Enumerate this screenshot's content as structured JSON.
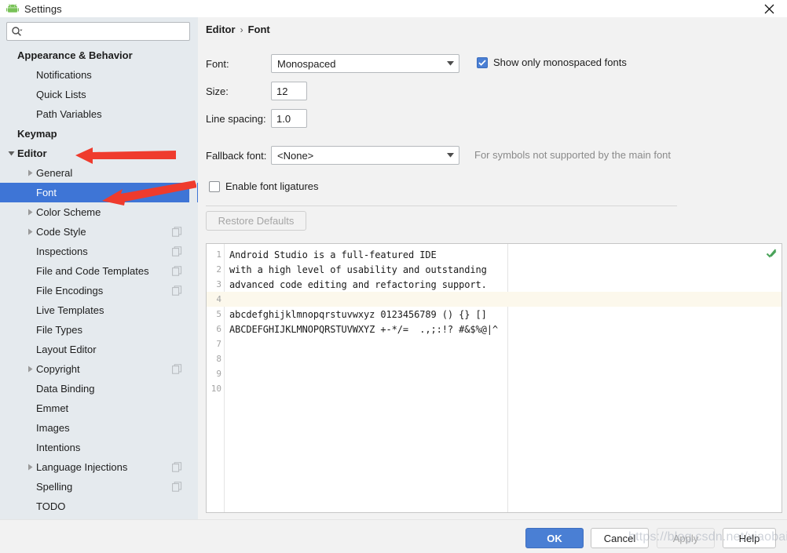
{
  "window": {
    "title": "Settings",
    "app_icon": "android-icon",
    "close_icon": "close-icon"
  },
  "sidebar": {
    "search": {
      "placeholder": "",
      "value": "",
      "icon": "search-icon"
    },
    "items": [
      {
        "label": "Appearance & Behavior",
        "level": 0,
        "twisty": "none",
        "selected": false,
        "badge": false
      },
      {
        "label": "Notifications",
        "level": 1,
        "twisty": "none",
        "selected": false,
        "badge": false
      },
      {
        "label": "Quick Lists",
        "level": 1,
        "twisty": "none",
        "selected": false,
        "badge": false
      },
      {
        "label": "Path Variables",
        "level": 1,
        "twisty": "none",
        "selected": false,
        "badge": false
      },
      {
        "label": "Keymap",
        "level": 0,
        "twisty": "none",
        "selected": false,
        "badge": false
      },
      {
        "label": "Editor",
        "level": 0,
        "twisty": "expanded",
        "selected": false,
        "badge": false
      },
      {
        "label": "General",
        "level": 1,
        "twisty": "collapsed",
        "selected": false,
        "badge": false
      },
      {
        "label": "Font",
        "level": 1,
        "twisty": "none",
        "selected": true,
        "badge": false
      },
      {
        "label": "Color Scheme",
        "level": 1,
        "twisty": "collapsed",
        "selected": false,
        "badge": false
      },
      {
        "label": "Code Style",
        "level": 1,
        "twisty": "collapsed",
        "selected": false,
        "badge": true
      },
      {
        "label": "Inspections",
        "level": 1,
        "twisty": "none",
        "selected": false,
        "badge": true
      },
      {
        "label": "File and Code Templates",
        "level": 1,
        "twisty": "none",
        "selected": false,
        "badge": true
      },
      {
        "label": "File Encodings",
        "level": 1,
        "twisty": "none",
        "selected": false,
        "badge": true
      },
      {
        "label": "Live Templates",
        "level": 1,
        "twisty": "none",
        "selected": false,
        "badge": false
      },
      {
        "label": "File Types",
        "level": 1,
        "twisty": "none",
        "selected": false,
        "badge": false
      },
      {
        "label": "Layout Editor",
        "level": 1,
        "twisty": "none",
        "selected": false,
        "badge": false
      },
      {
        "label": "Copyright",
        "level": 1,
        "twisty": "collapsed",
        "selected": false,
        "badge": true
      },
      {
        "label": "Data Binding",
        "level": 1,
        "twisty": "none",
        "selected": false,
        "badge": false
      },
      {
        "label": "Emmet",
        "level": 1,
        "twisty": "none",
        "selected": false,
        "badge": false
      },
      {
        "label": "Images",
        "level": 1,
        "twisty": "none",
        "selected": false,
        "badge": false
      },
      {
        "label": "Intentions",
        "level": 1,
        "twisty": "none",
        "selected": false,
        "badge": false
      },
      {
        "label": "Language Injections",
        "level": 1,
        "twisty": "collapsed",
        "selected": false,
        "badge": true
      },
      {
        "label": "Spelling",
        "level": 1,
        "twisty": "none",
        "selected": false,
        "badge": true
      },
      {
        "label": "TODO",
        "level": 1,
        "twisty": "none",
        "selected": false,
        "badge": false
      }
    ]
  },
  "content": {
    "breadcrumb": {
      "root": "Editor",
      "separator": "›",
      "leaf": "Font"
    },
    "font_label": "Font:",
    "font_value": "Monospaced",
    "size_label": "Size:",
    "size_value": "12",
    "line_spacing_label": "Line spacing:",
    "line_spacing_value": "1.0",
    "fallback_label": "Fallback font:",
    "fallback_value": "<None>",
    "fallback_hint": "For symbols not supported by the main font",
    "monospaced_checkbox": {
      "label": "Show only monospaced fonts",
      "checked": true
    },
    "ligatures_checkbox": {
      "label": "Enable font ligatures",
      "checked": false
    },
    "restore_defaults_label": "Restore Defaults"
  },
  "preview": {
    "status_icon": "green-check-icon",
    "highlighted_line": 4,
    "lines": [
      {
        "number": "1",
        "text": "Android Studio is a full-featured IDE"
      },
      {
        "number": "2",
        "text": "with a high level of usability and outstanding"
      },
      {
        "number": "3",
        "text": "advanced code editing and refactoring support."
      },
      {
        "number": "4",
        "text": ""
      },
      {
        "number": "5",
        "text": "abcdefghijklmnopqrstuvwxyz 0123456789 () {} []"
      },
      {
        "number": "6",
        "text": "ABCDEFGHIJKLMNOPQRSTUVWXYZ +-*/=  .,;:!? #&$%@|^"
      },
      {
        "number": "7",
        "text": ""
      },
      {
        "number": "8",
        "text": ""
      },
      {
        "number": "9",
        "text": ""
      },
      {
        "number": "10",
        "text": ""
      }
    ]
  },
  "footer": {
    "ok": "OK",
    "cancel": "Cancel",
    "apply": "Apply",
    "help": "Help"
  },
  "watermark": "https://blog.csdn.net/xiaobailang",
  "colors": {
    "selection_blue": "#3e75d6",
    "primary_button": "#4a7fd4",
    "sidebar_bg": "#e5eaee",
    "panel_bg": "#f2f2f2",
    "annotation_red": "#ef3b2d",
    "highlight_line": "#fcf8ec",
    "status_green": "#4aa35a"
  }
}
